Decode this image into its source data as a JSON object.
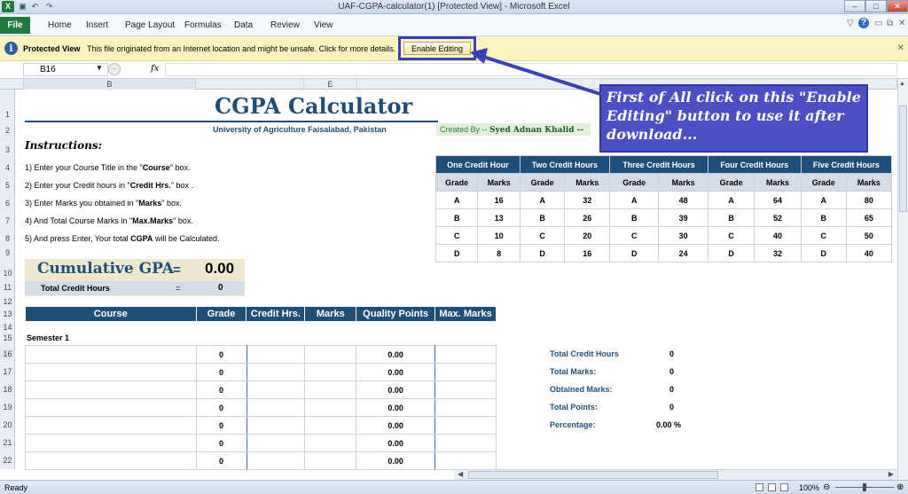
{
  "window": {
    "title": "UAF-CGPA-calculator(1)  [Protected View] - Microsoft Excel",
    "app_icon": "X"
  },
  "ribbon": {
    "file": "File",
    "tabs": [
      "Home",
      "Insert",
      "Page Layout",
      "Formulas",
      "Data",
      "Review",
      "View"
    ]
  },
  "protected_bar": {
    "label": "Protected View",
    "message": "This file originated from an Internet location and might be unsafe. Click for more details.",
    "button": "Enable Editing"
  },
  "formula_bar": {
    "name_box": "B16",
    "fx": "fx"
  },
  "columns": {
    "b": "B",
    "e": "E"
  },
  "rows": [
    "1",
    "2",
    "3",
    "4",
    "5",
    "6",
    "7",
    "8",
    "9",
    "10",
    "11",
    "12",
    "13",
    "14",
    "15",
    "16",
    "17",
    "18",
    "19",
    "20",
    "21",
    "22"
  ],
  "sheet": {
    "title": "CGPA Calculator",
    "university": "University of Agriculture Faisalabad, Pakistan",
    "created_by_prefix": "Created By -- ",
    "created_by_name": "Syed Adnan Khalid --",
    "instructions_heading": "Instructions:",
    "instructions": [
      {
        "a": "1) Enter your Course Title in the \"",
        "b": "Course",
        "c": "\" box."
      },
      {
        "a": "2) Enter your Credit hours in \"",
        "b": "Credit Hrs.",
        "c": "\" box ."
      },
      {
        "a": "3) Enter Marks you obtained in \"",
        "b": "Marks",
        "c": "\" box."
      },
      {
        "a": "4) And Total Course Marks in \"",
        "b": "Max.Marks",
        "c": "\" box."
      },
      {
        "a": "5) And press Enter, Your total ",
        "b": "CGPA",
        "c": " will be Calculated."
      }
    ],
    "grade_table": {
      "groups": [
        "One Credit Hour",
        "Two Credit Hours",
        "Three Credit Hours",
        "Four Credit Hours",
        "Five Credit Hours"
      ],
      "sub": [
        "Grade",
        "Marks"
      ],
      "rows": [
        [
          "A",
          "16",
          "A",
          "32",
          "A",
          "48",
          "A",
          "64",
          "A",
          "80"
        ],
        [
          "B",
          "13",
          "B",
          "26",
          "B",
          "39",
          "B",
          "52",
          "B",
          "65"
        ],
        [
          "C",
          "10",
          "C",
          "20",
          "C",
          "30",
          "C",
          "40",
          "C",
          "50"
        ],
        [
          "D",
          "8",
          "D",
          "16",
          "D",
          "24",
          "D",
          "32",
          "D",
          "40"
        ]
      ]
    },
    "cgpa": {
      "label": "Cumulative GPA",
      "eq": "=",
      "value": "0.00",
      "tch_label": "Total Credit Hours",
      "tch_eq": "=",
      "tch_value": "0"
    },
    "course_headers": [
      "Course",
      "Grade",
      "Credit Hrs.",
      "Marks",
      "Quality Points",
      "Max. Marks"
    ],
    "semester": "Semester 1",
    "course_rows": [
      {
        "grade": "0",
        "qp": "0.00"
      },
      {
        "grade": "0",
        "qp": "0.00"
      },
      {
        "grade": "0",
        "qp": "0.00"
      },
      {
        "grade": "0",
        "qp": "0.00"
      },
      {
        "grade": "0",
        "qp": "0.00"
      },
      {
        "grade": "0",
        "qp": "0.00"
      },
      {
        "grade": "0",
        "qp": "0.00"
      }
    ],
    "totals": [
      {
        "label": "Total Credit Hours",
        "value": "0"
      },
      {
        "label": "Total Marks:",
        "value": "0"
      },
      {
        "label": "Obtained Marks:",
        "value": "0"
      },
      {
        "label": "Total Points:",
        "value": "0"
      },
      {
        "label": "Percentage:",
        "value": "0.00 %"
      }
    ]
  },
  "callout": {
    "text": "First of All click on this \"Enable Editing\" button to use it after download..."
  },
  "status": {
    "ready": "Ready",
    "zoom": "100%"
  },
  "colors": {
    "accent": "#1f4e79",
    "callout": "#4b4fc4",
    "protected_bar": "#fcf3bf"
  }
}
